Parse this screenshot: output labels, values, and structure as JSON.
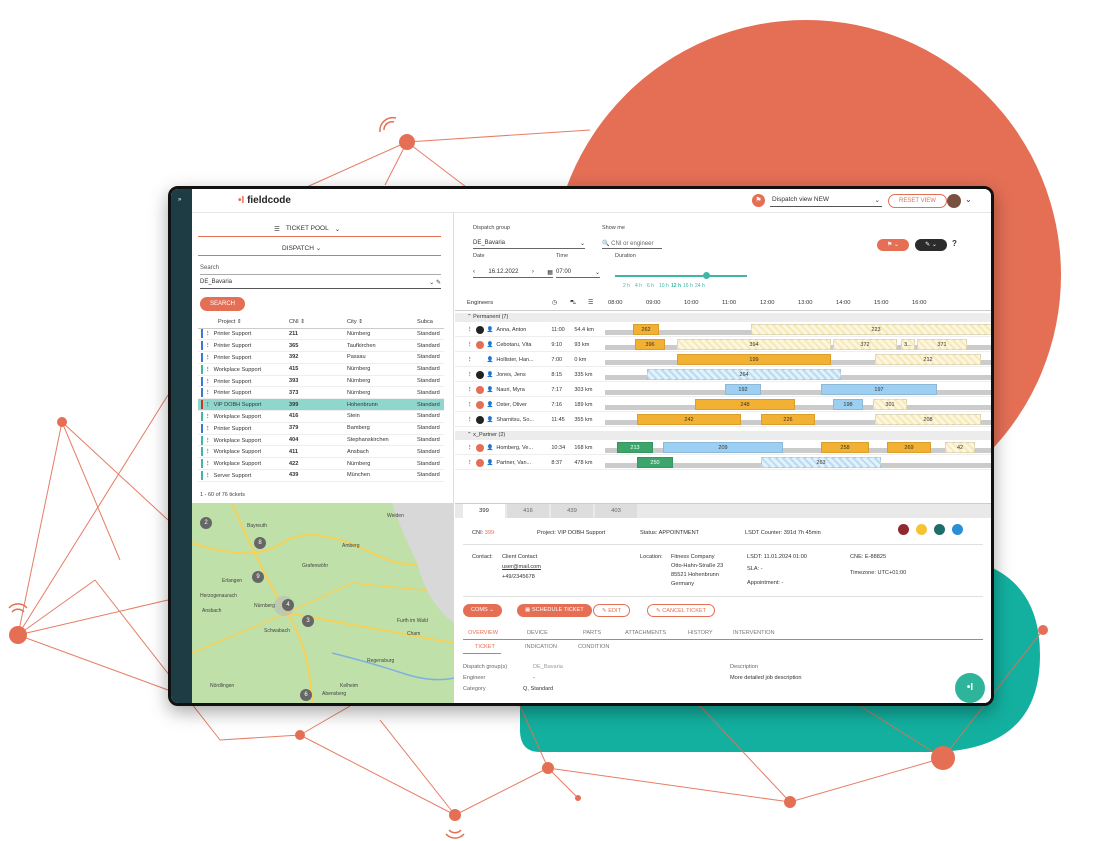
{
  "app": {
    "logo_text": "fieldcode",
    "dispatch_view": "Dispatch view NEW",
    "reset_view": "RESET VIEW"
  },
  "left": {
    "ticket_pool": "TICKET POOL",
    "dispatch": "DISPATCH",
    "search_label": "Search",
    "group_value": "DE_Bavaria",
    "search_button": "SEARCH",
    "columns": [
      "Project ⇕",
      "CNI ⇕",
      "City ⇕",
      "Subca"
    ],
    "rows": [
      {
        "project": "Printer Support",
        "cni": "211",
        "city": "Nürnberg",
        "sub": "Standard",
        "color": "#3b77d9"
      },
      {
        "project": "Printer Support",
        "cni": "365",
        "city": "Taufkirchen",
        "sub": "Standard",
        "color": "#3b77d9"
      },
      {
        "project": "Printer Support",
        "cni": "392",
        "city": "Passau",
        "sub": "Standard",
        "color": "#3b77d9"
      },
      {
        "project": "Workplace Support",
        "cni": "415",
        "city": "Nürnberg",
        "sub": "Standard",
        "color": "#3fb7a6"
      },
      {
        "project": "Printer Support",
        "cni": "393",
        "city": "Nürnberg",
        "sub": "Standard",
        "color": "#3b77d9"
      },
      {
        "project": "Printer Support",
        "cni": "373",
        "city": "Nürnberg",
        "sub": "Standard",
        "color": "#3b77d9"
      },
      {
        "project": "VIP DOBH Support",
        "cni": "399",
        "city": "Hohenbrunn",
        "sub": "Standard",
        "color": "#c0392b",
        "selected": true
      },
      {
        "project": "Workplace Support",
        "cni": "416",
        "city": "Stein",
        "sub": "Standard",
        "color": "#3fb7a6"
      },
      {
        "project": "Printer Support",
        "cni": "379",
        "city": "Bamberg",
        "sub": "Standard",
        "color": "#3b77d9"
      },
      {
        "project": "Workplace Support",
        "cni": "404",
        "city": "Stephanskirchen",
        "sub": "Standard",
        "color": "#3fb7a6"
      },
      {
        "project": "Workplace Support",
        "cni": "411",
        "city": "Ansbach",
        "sub": "Standard",
        "color": "#3fb7a6"
      },
      {
        "project": "Workplace Support",
        "cni": "422",
        "city": "Nürnberg",
        "sub": "Standard",
        "color": "#3fb7a6"
      },
      {
        "project": "Server Support",
        "cni": "439",
        "city": "München",
        "sub": "Standard",
        "color": "#3fb7a6"
      }
    ],
    "count": "1 - 60 of 76 tickets"
  },
  "map": {
    "labels": [
      "Bayreuth",
      "Erlangen",
      "Nürnberg",
      "Regensburg",
      "Herzogenaurach",
      "Schwabach",
      "Nördlingen",
      "Kelheim",
      "Cham",
      "Furth im Wald",
      "Amberg",
      "Weiden",
      "Grafenwöhr",
      "Ansbach",
      "Abensberg",
      "Teuchtlingen"
    ],
    "pins": [
      "2",
      "8",
      "9",
      "4",
      "3",
      "6"
    ]
  },
  "dispatch": {
    "group_label": "Dispatch group",
    "group_value": "DE_Bavaria",
    "show_me_label": "Show me",
    "show_me_placeholder": "CNI or engineer",
    "date_label": "Date",
    "date_value": "16.12.2022",
    "time_label": "Time",
    "time_value": "07:00",
    "duration_label": "Duration",
    "durations": [
      "2 h",
      "4 h",
      "6 h",
      "10 h",
      "12 h",
      "16 h",
      "24 h"
    ],
    "engineers_label": "Engineers",
    "hours": [
      "08:00",
      "09:00",
      "10:00",
      "11:00",
      "12:00",
      "13:00",
      "14:00",
      "15:00",
      "16:00"
    ],
    "permanent": "Permanent (7)",
    "partner": "x_Partner (2)",
    "engineers": [
      {
        "name": "Anna, Anton",
        "time": "11:00",
        "dist": "54.4 km"
      },
      {
        "name": "Cebotaru, Vita",
        "time": "9:10",
        "dist": "93 km"
      },
      {
        "name": "Hollister, Han...",
        "time": "7:00",
        "dist": "0 km"
      },
      {
        "name": "Jones, Jens",
        "time": "8:15",
        "dist": "335 km"
      },
      {
        "name": "Nauri, Myra",
        "time": "7:17",
        "dist": "303 km"
      },
      {
        "name": "Oster, Oliver",
        "time": "7:16",
        "dist": "189 km"
      },
      {
        "name": "Sharnitsu, So...",
        "time": "11:45",
        "dist": "355 km"
      },
      {
        "name": "Homberg, Ve...",
        "time": "10:34",
        "dist": "168 km"
      },
      {
        "name": "Partner, Van...",
        "time": "8:37",
        "dist": "478 km"
      }
    ],
    "block_labels": [
      "262",
      "223",
      "396",
      "394",
      "372",
      "3...",
      "371",
      "199",
      "212",
      "264",
      "192",
      "197",
      "248",
      "198",
      "301",
      "242",
      "226",
      "208",
      "213",
      "209",
      "258",
      "269",
      "42",
      "250",
      "263"
    ]
  },
  "detail": {
    "tabs": [
      "399",
      "416",
      "439",
      "403"
    ],
    "cni_label": "CNI:",
    "cni": "399",
    "project": "Project:  VIP DOBH Support",
    "status": "Status:  APPOINTMENT",
    "lsdt_counter": "LSDT Counter:  391d 7h 45min",
    "contact_label": "Contact:",
    "contact": [
      "Client Contact",
      "user@mail.com",
      "+49/2345678"
    ],
    "location_label": "Location:",
    "location": [
      "Fitness Company",
      "Otto-Hahn-Straße 23",
      "85521 Hohenbrunn",
      "Germany"
    ],
    "lsdt": "LSDT:  11.01.2024 01:00",
    "sla": "SLA:  -",
    "appointment": "Appointment:  -",
    "cne": "CNE:  E-88825",
    "timezone": "Timezone:  UTC+01:00",
    "buttons": [
      "COMS",
      "SCHEDULE TICKET",
      "EDIT",
      "CANCEL TICKET"
    ],
    "subtabs": [
      "OVERVIEW",
      "DEVICE",
      "PARTS",
      "ATTACHMENTS",
      "HISTORY",
      "INTERVENTION"
    ],
    "subtabs2": [
      "TICKET",
      "INDICATION",
      "CONDITION"
    ],
    "fields": [
      "Dispatch group(s)",
      "DE_Bavaria",
      "Engineer",
      "-",
      "Category",
      "Q, Standard",
      "Description",
      "More detailed job description"
    ]
  }
}
